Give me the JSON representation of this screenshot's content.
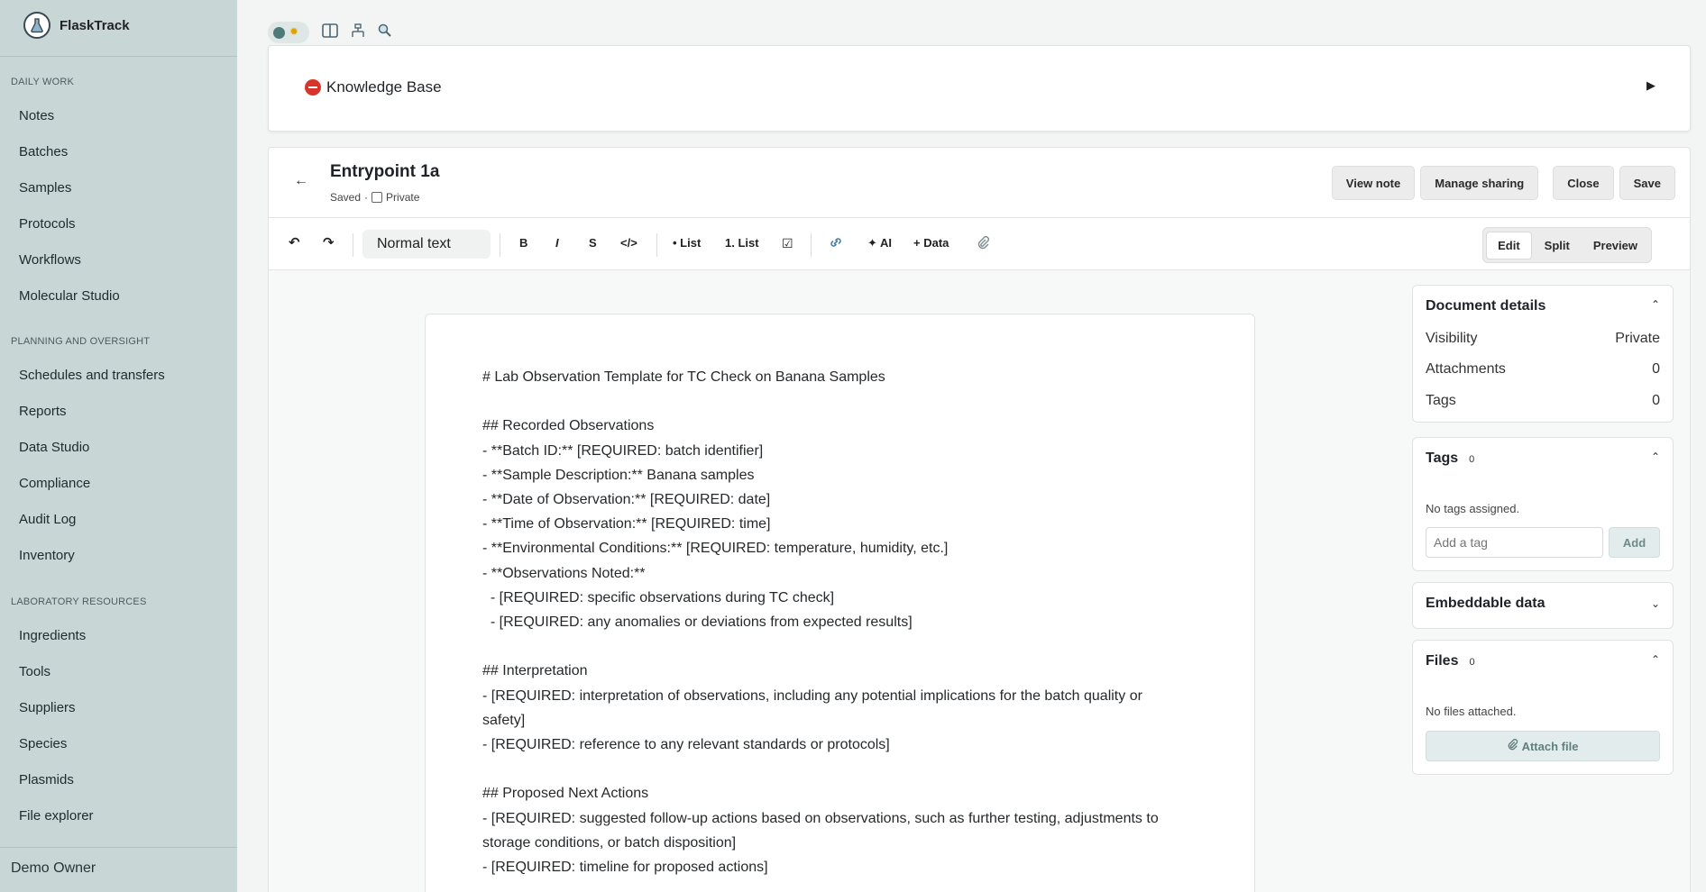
{
  "app": {
    "name": "FlaskTrack",
    "owner": "Demo Owner"
  },
  "sidebar": {
    "sections": [
      {
        "label": "Daily work",
        "items": [
          "Notes",
          "Batches",
          "Samples",
          "Protocols",
          "Workflows",
          "Molecular Studio"
        ]
      },
      {
        "label": "Planning and oversight",
        "items": [
          "Schedules and transfers",
          "Reports",
          "Data Studio",
          "Compliance",
          "Audit Log",
          "Inventory"
        ]
      },
      {
        "label": "Laboratory resources",
        "items": [
          "Ingredients",
          "Tools",
          "Suppliers",
          "Species",
          "Plasmids",
          "File explorer"
        ]
      }
    ]
  },
  "knowledge_base": {
    "title": "Knowledge Base",
    "toggle_icon": "▶"
  },
  "note": {
    "title": "Entrypoint 1a",
    "status": "Saved",
    "dot": "·",
    "private_label": "Private",
    "buttons": {
      "view": "View note",
      "share": "Manage sharing",
      "close": "Close",
      "save": "Save"
    },
    "back_icon": "←"
  },
  "toolbar": {
    "undo": "↶",
    "redo": "↷",
    "text_style": "Normal text",
    "bold": "B",
    "italic": "I",
    "strike": "S",
    "code": "</>",
    "bullet_list": "• List",
    "ordered_list": "1. List",
    "checklist": "☑",
    "link": "🔗",
    "ai": "✦ AI",
    "data": "+ Data",
    "attach": "📎",
    "modes": [
      "Edit",
      "Split",
      "Preview"
    ],
    "active_mode": "Edit"
  },
  "document": {
    "lines": [
      "# Lab Observation Template for TC Check on Banana Samples",
      "",
      "## Recorded Observations",
      "- **Batch ID:** [REQUIRED: batch identifier]",
      "- **Sample Description:** Banana samples",
      "- **Date of Observation:** [REQUIRED: date]",
      "- **Time of Observation:** [REQUIRED: time]",
      "- **Environmental Conditions:** [REQUIRED: temperature, humidity, etc.]",
      "- **Observations Noted:**",
      "  - [REQUIRED: specific observations during TC check]",
      "  - [REQUIRED: any anomalies or deviations from expected results]",
      "",
      "## Interpretation",
      "- [REQUIRED: interpretation of observations, including any potential implications for the batch quality or",
      "safety]",
      "- [REQUIRED: reference to any relevant standards or protocols]",
      "",
      "## Proposed Next Actions",
      "- [REQUIRED: suggested follow-up actions based on observations, such as further testing, adjustments to",
      "storage conditions, or batch disposition]",
      "- [REQUIRED: timeline for proposed actions]"
    ]
  },
  "details": {
    "title": "Document details",
    "rows": [
      {
        "label": "Visibility",
        "value": "Private"
      },
      {
        "label": "Attachments",
        "value": "0"
      },
      {
        "label": "Tags",
        "value": "0"
      }
    ]
  },
  "tags": {
    "title": "Tags",
    "count": "0",
    "empty": "No tags assigned.",
    "placeholder": "Add a tag",
    "add_label": "Add"
  },
  "embeddable": {
    "title": "Embeddable data"
  },
  "files": {
    "title": "Files",
    "count": "0",
    "empty": "No files attached.",
    "attach_label": "Attach file"
  },
  "colors": {
    "sidebar": "#c8d6d6",
    "accent": "#4c7b7a",
    "danger": "#d8342c"
  }
}
